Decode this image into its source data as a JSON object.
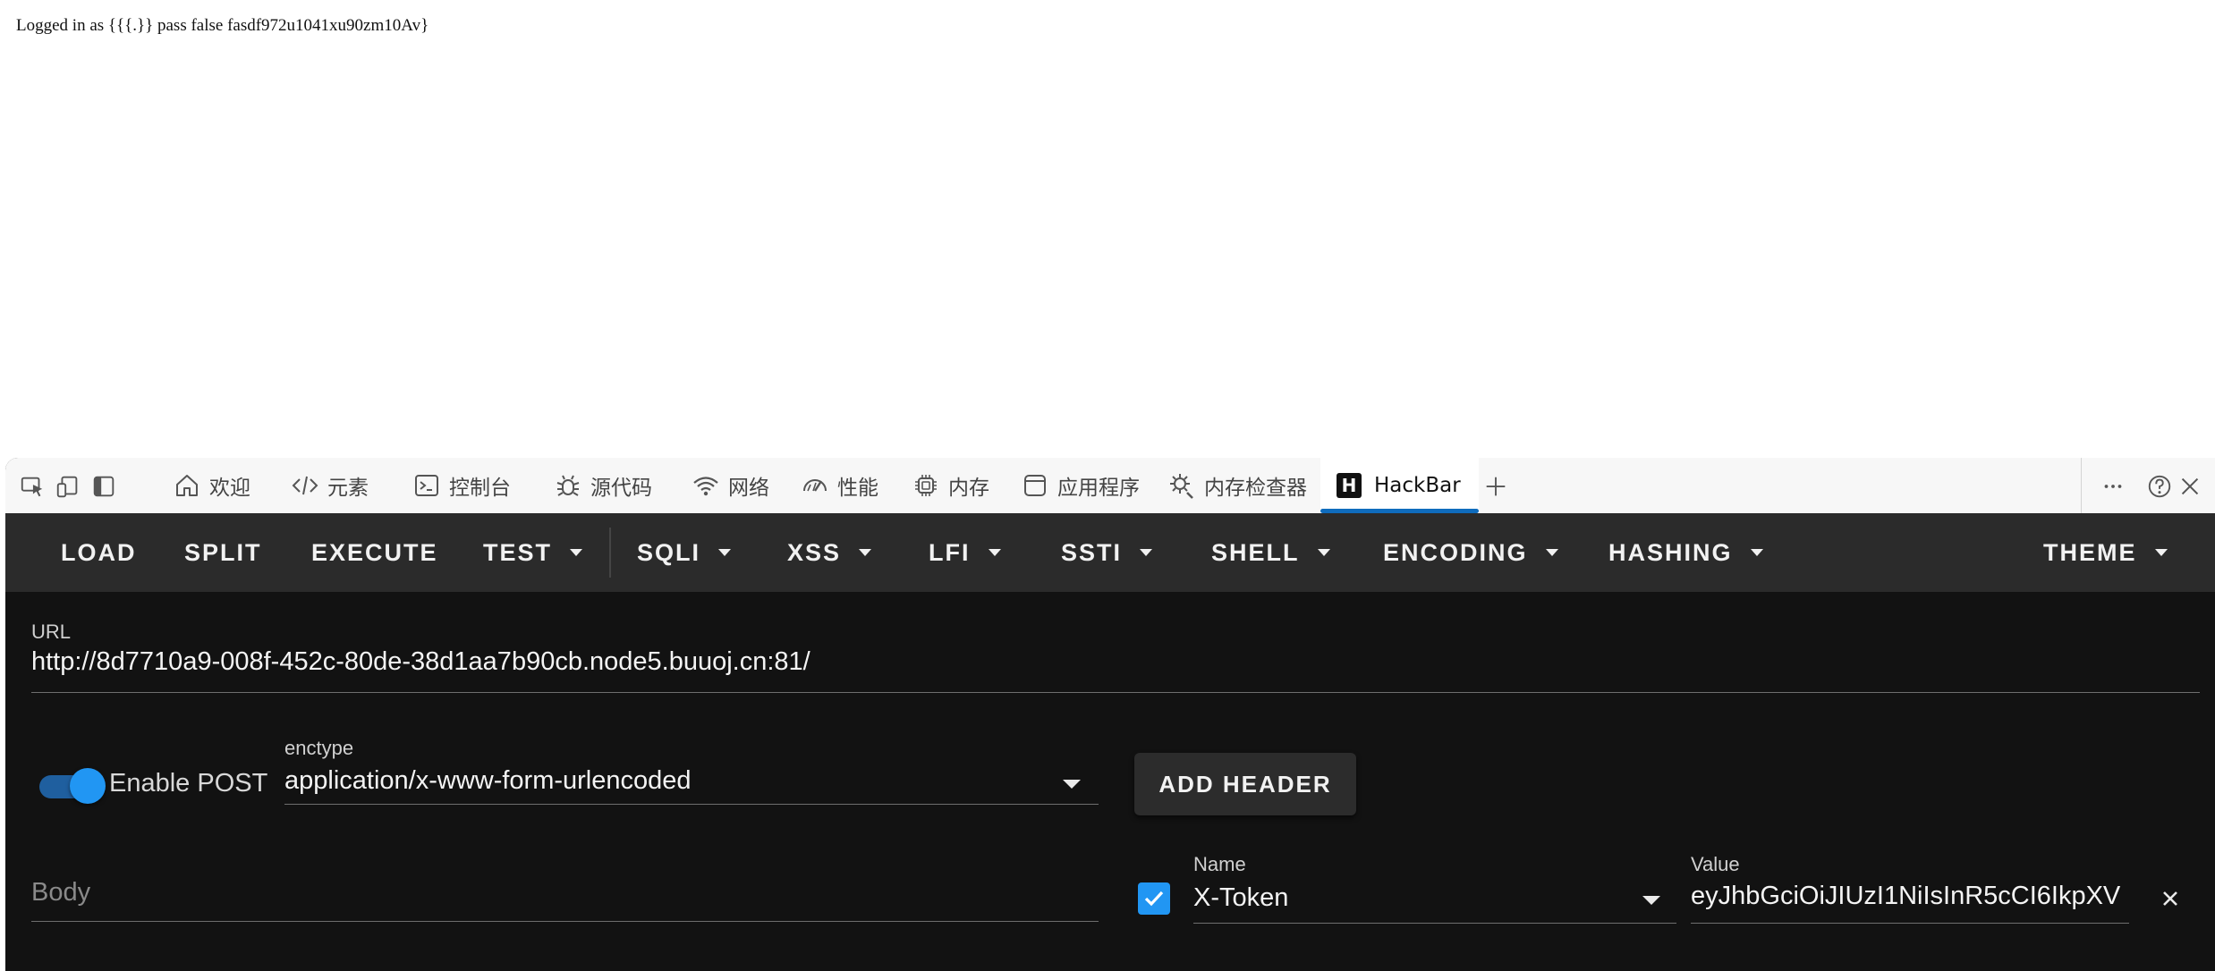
{
  "page": {
    "text": "Logged in as {{{.}} pass false fasdf972u1041xu90zm10Av}"
  },
  "devtools": {
    "tabs": [
      {
        "label": "欢迎",
        "icon": "home-icon"
      },
      {
        "label": "元素",
        "icon": "code-icon"
      },
      {
        "label": "控制台",
        "icon": "console-icon"
      },
      {
        "label": "源代码",
        "icon": "bug-icon"
      },
      {
        "label": "网络",
        "icon": "wifi-icon"
      },
      {
        "label": "性能",
        "icon": "gauge-icon"
      },
      {
        "label": "内存",
        "icon": "chip-icon"
      },
      {
        "label": "应用程序",
        "icon": "app-window-icon"
      },
      {
        "label": "内存检查器",
        "icon": "memory-inspector-icon"
      },
      {
        "label": "HackBar",
        "icon": "hackbar-logo-icon",
        "logo_letter": "H",
        "active": true
      }
    ],
    "add_tab_icon": "plus-icon",
    "right_icons": [
      "more-icon",
      "help-icon",
      "close-icon"
    ]
  },
  "hackbar": {
    "toolbar": {
      "load": "LOAD",
      "split": "SPLIT",
      "execute": "EXECUTE",
      "test": "TEST",
      "sqli": "SQLI",
      "xss": "XSS",
      "lfi": "LFI",
      "ssti": "SSTI",
      "shell": "SHELL",
      "encoding": "ENCODING",
      "hashing": "HASHING",
      "theme": "THEME"
    },
    "url": {
      "label": "URL",
      "value": "http://8d7710a9-008f-452c-80de-38d1aa7b90cb.node5.buuoj.cn:81/"
    },
    "post": {
      "toggle_label": "Enable POST",
      "enabled": true,
      "enctype_label": "enctype",
      "enctype_value": "application/x-www-form-urlencoded",
      "body_placeholder": "Body"
    },
    "add_header_label": "ADD HEADER",
    "header": {
      "checked": true,
      "name_label": "Name",
      "name_value": "X-Token",
      "value_label": "Value",
      "value_value": "eyJhbGciOiJIUzI1NiIsInR5cCI6IkpXV"
    },
    "colors": {
      "accent": "#2196f3",
      "toolbar_bg": "#2b2b2b",
      "panel_bg": "#121212"
    }
  }
}
